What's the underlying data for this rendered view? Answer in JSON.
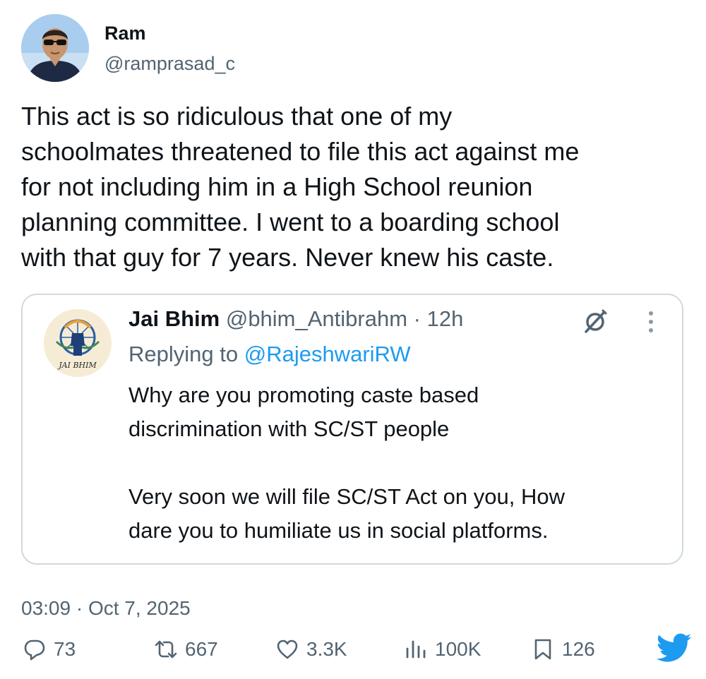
{
  "tweet": {
    "author": {
      "name": "Ram",
      "handle": "@ramprasad_c"
    },
    "text": "This act is so ridiculous that one of my\nschoolmates threatened to file this act against me\nfor not including him in a High School reunion\nplanning committee. I went to a boarding school\nwith that guy for 7 years. Never knew his caste.",
    "timestamp": "03:09 · Oct 7, 2025"
  },
  "quote": {
    "author": {
      "name": "Jai Bhim",
      "handle": "@bhim_Antibrahm"
    },
    "age": "· 12h",
    "avatar_text": "JAI BHIM",
    "replying_prefix": "Replying to",
    "replying_to": "@RajeshwariRW",
    "text": "Why are you promoting caste based\ndiscrimination with SC/ST people\n\nVery soon we will file SC/ST Act on you, How\ndare you to humiliate us in social platforms."
  },
  "stats": {
    "replies": "73",
    "reposts": "667",
    "likes": "3.3K",
    "views": "100K",
    "bookmarks": "126"
  },
  "colors": {
    "text": "#0f1419",
    "secondary": "#536471",
    "accent": "#1d9bf0",
    "border": "#cfd9de"
  },
  "icons": [
    "grok-icon",
    "more-icon",
    "reply-icon",
    "repost-icon",
    "like-icon",
    "views-icon",
    "bookmark-icon",
    "twitter-bird-icon"
  ]
}
